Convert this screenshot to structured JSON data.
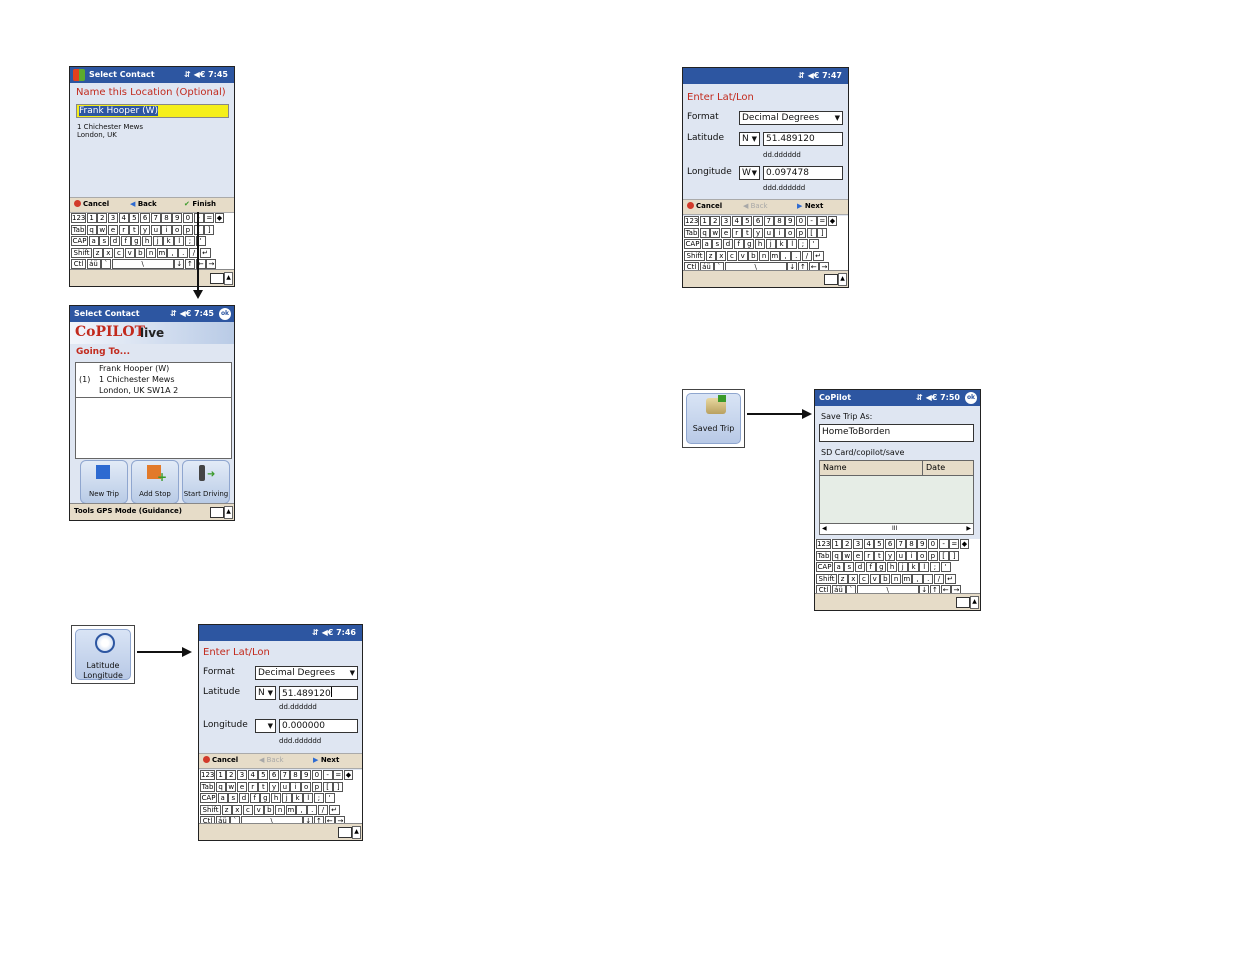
{
  "common": {
    "time_745": "7:45",
    "time_746": "7:46",
    "time_747": "7:47",
    "time_750": "7:50",
    "tray_icons": "⇵ ◀€",
    "ok_label": "ok",
    "cancel": "Cancel",
    "back": "Back",
    "next": "Next",
    "finish": "Finish"
  },
  "keyboard": {
    "row1": [
      "123",
      "1",
      "2",
      "3",
      "4",
      "5",
      "6",
      "7",
      "8",
      "9",
      "0",
      "-",
      "=",
      "◆"
    ],
    "row2": [
      "Tab",
      "q",
      "w",
      "e",
      "r",
      "t",
      "y",
      "u",
      "i",
      "o",
      "p",
      "[",
      "]"
    ],
    "row3": [
      "CAP",
      "a",
      "s",
      "d",
      "f",
      "g",
      "h",
      "j",
      "k",
      "l",
      ";",
      "'"
    ],
    "row4": [
      "Shift",
      "z",
      "x",
      "c",
      "v",
      "b",
      "n",
      "m",
      ",",
      ".",
      "/",
      "↵"
    ],
    "row5": [
      "Ctl",
      "áü",
      "`",
      "\\",
      "↓",
      "↑",
      "←",
      "→"
    ]
  },
  "screen1": {
    "title": "Select Contact",
    "heading": "Name this Location (Optional)",
    "name_value": "Frank Hooper (W)",
    "address_line1": "1 Chichester Mews",
    "address_line2": "London, UK"
  },
  "screen2": {
    "title": "Select Contact",
    "brand": "CoPILOT",
    "brand_suffix": "live",
    "heading": "Going To...",
    "stop_index": "(1)",
    "stop_line1": "Frank Hooper (W)",
    "stop_line2": "1 Chichester Mews",
    "stop_line3": "London, UK SW1A 2",
    "btn_new_trip": "New Trip",
    "btn_add_stop": "Add Stop",
    "btn_start_driving": "Start Driving",
    "menu": "Tools GPS Mode (Guidance)"
  },
  "latlon_tile": {
    "line1": "Latitude",
    "line2": "Longitude"
  },
  "saved_tile": {
    "label": "Saved Trip"
  },
  "screen3": {
    "heading": "Enter Lat/Lon",
    "format_label": "Format",
    "format_value": "Decimal Degrees",
    "lat_label": "Latitude",
    "lat_dir": "N",
    "lat_value": "51.489120",
    "lat_hint": "dd.dddddd",
    "lon_label": "Longitude",
    "lon_dir": "",
    "lon_value": "0.000000",
    "lon_hint": "ddd.dddddd"
  },
  "screen4": {
    "heading": "Enter Lat/Lon",
    "format_label": "Format",
    "format_value": "Decimal Degrees",
    "lat_label": "Latitude",
    "lat_dir": "N",
    "lat_value": "51.489120",
    "lat_hint": "dd.dddddd",
    "lon_label": "Longitude",
    "lon_dir": "W",
    "lon_value": "0.097478",
    "lon_hint": "ddd.dddddd"
  },
  "screen5": {
    "title": "CoPilot",
    "save_label": "Save Trip As:",
    "save_value": "HomeToBorden",
    "path": "SD Card/copilot/save",
    "col_name": "Name",
    "col_date": "Date",
    "scroll_mid": "III"
  },
  "colors": {
    "titlebar": "#2d56a1",
    "heading_red": "#c22a1d",
    "highlight": "#f5ef1a",
    "cmdbar": "#e6dcc8"
  }
}
